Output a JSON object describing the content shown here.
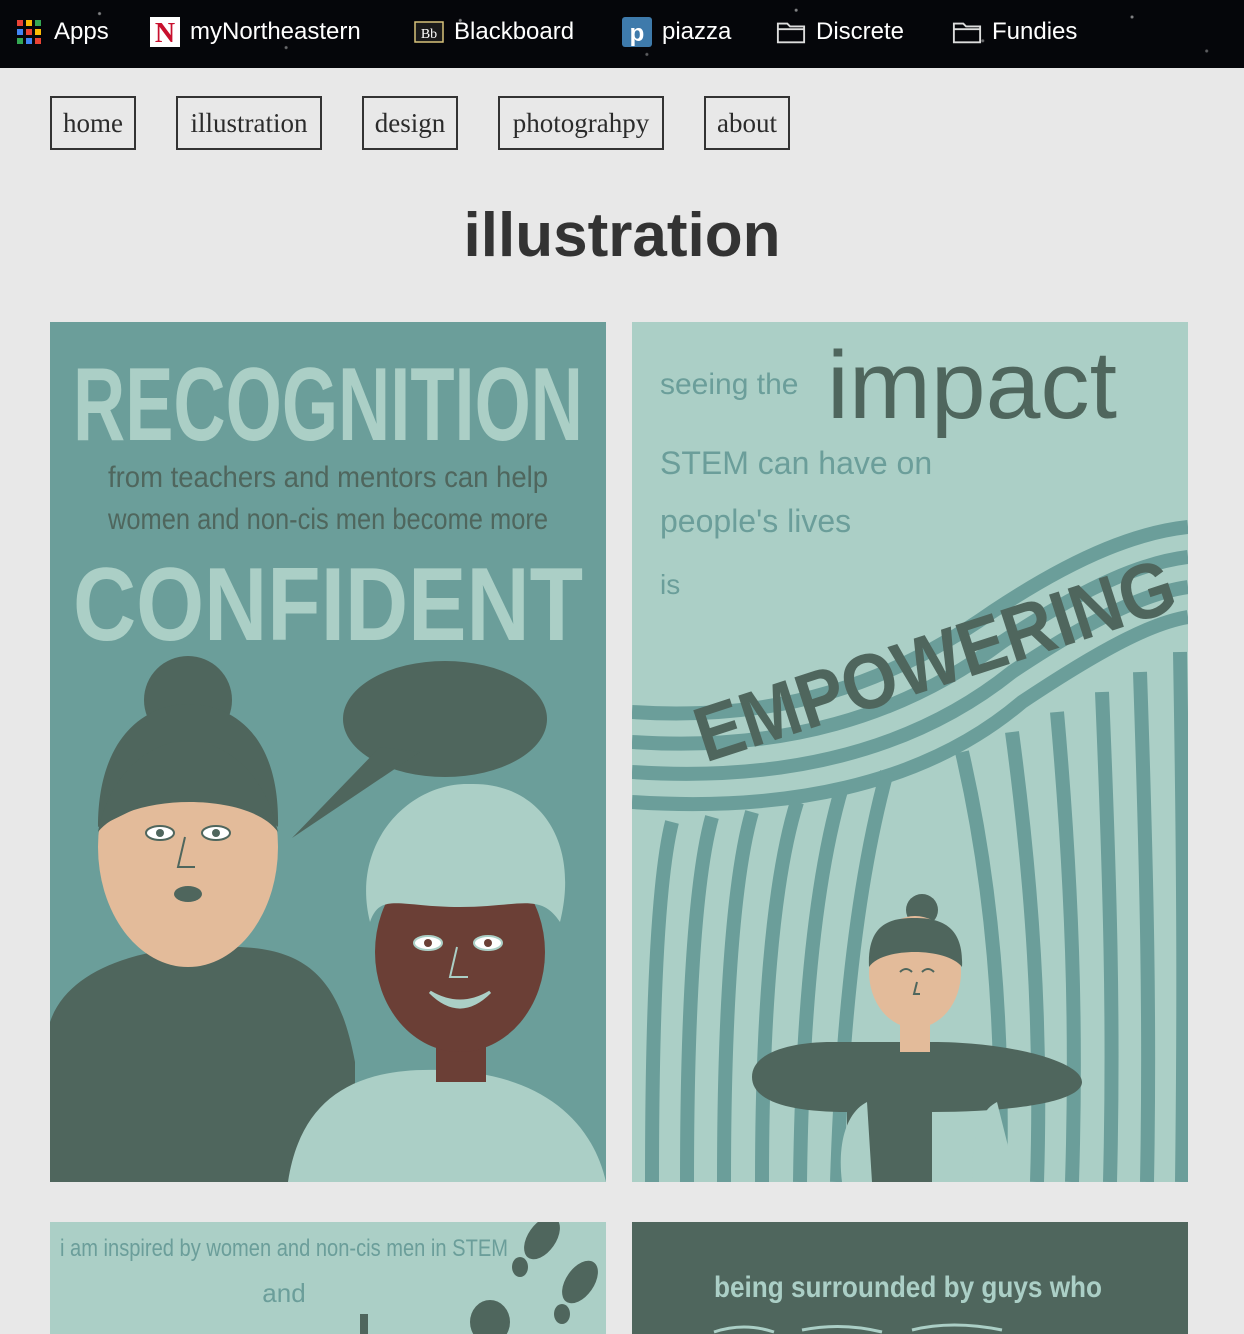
{
  "bookmarks": [
    {
      "label": "Apps",
      "icon": "apps-grid-icon"
    },
    {
      "label": "myNortheastern",
      "icon": "northeastern-icon"
    },
    {
      "label": "Blackboard",
      "icon": "blackboard-icon"
    },
    {
      "label": "piazza",
      "icon": "piazza-icon"
    },
    {
      "label": "Discrete",
      "icon": "folder-icon"
    },
    {
      "label": "Fundies",
      "icon": "folder-icon"
    }
  ],
  "nav": [
    {
      "label": "home"
    },
    {
      "label": "illustration"
    },
    {
      "label": "design"
    },
    {
      "label": "photograhpy"
    },
    {
      "label": "about"
    }
  ],
  "page": {
    "title": "illustration"
  },
  "illustrations": [
    {
      "headline": "RECOGNITION",
      "line1": "from teachers and mentors can help",
      "line2": "women and non-cis men become more",
      "headline2": "CONFIDENT"
    },
    {
      "text1": "seeing the",
      "big": "impact",
      "text2": "STEM can have on",
      "text3": "people's lives",
      "text4": "is",
      "banner": "EMPOWERING"
    },
    {
      "line1": "i am inspired by women and non-cis men in STEM",
      "line2": "and"
    },
    {
      "line1": "being surrounded by guys who"
    }
  ],
  "colors": {
    "page_bg": "#e8e8e8",
    "teal_dark": "#4f665d",
    "teal_mid": "#6b9e9a",
    "teal_light": "#abcfc6",
    "skin_light": "#e3bb9a",
    "skin_dark": "#6b3f36"
  }
}
